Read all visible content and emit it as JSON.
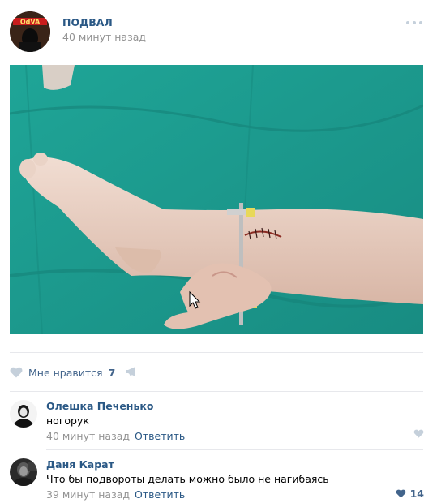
{
  "post": {
    "author": "ПОДВАЛ",
    "time": "40 минут назад",
    "avatar_text": "OdVA"
  },
  "actions": {
    "like_label": "Мне нравится",
    "like_count": "7"
  },
  "comments": [
    {
      "author": "Олешка Печенько",
      "text": "ногорук",
      "time": "40 минут назад",
      "reply": "Ответить",
      "likes": ""
    },
    {
      "author": "Даня Карат",
      "text": "Что бы подвороты делать можно было не нагибаясь",
      "time": "39 минут назад",
      "reply": "Ответить",
      "likes": "14"
    }
  ],
  "colors": {
    "link": "#2a5885",
    "muted": "#939393",
    "icon": "#c5d0db",
    "photo_bg": "#1d9b91"
  }
}
